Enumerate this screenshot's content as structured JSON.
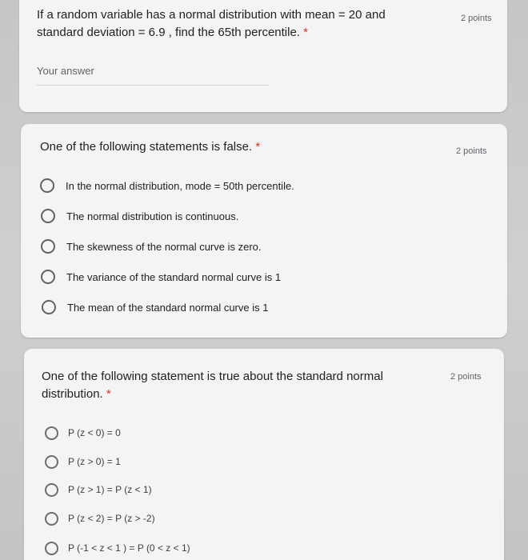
{
  "questions": [
    {
      "title_line1": "If a random variable has a normal distribution with mean = 20 and",
      "title_line2": "standard deviation = 6.9 , find the 65th percentile.",
      "required_mark": "*",
      "points": "2 points",
      "answer_placeholder": "Your answer"
    },
    {
      "title": "One of the following statements is false.",
      "required_mark": "*",
      "points": "2 points",
      "options": [
        "In the normal distribution, mode = 50th percentile.",
        "The normal distribution is continuous.",
        "The skewness of the normal curve is zero.",
        "The variance of the standard normal curve is 1",
        "The mean of the standard normal curve is 1"
      ]
    },
    {
      "title_line1": "One of the following statement is true about the standard normal",
      "title_line2": "distribution.",
      "required_mark": "*",
      "points": "2 points",
      "options": [
        "P (z < 0) = 0",
        "P (z > 0) = 1",
        "P (z > 1) = P (z < 1)",
        "P (z < 2) = P (z > -2)",
        "P (-1 < z < 1 ) = P (0 < z < 1)"
      ]
    }
  ],
  "colors": {
    "required": "#d93025",
    "card_bg": "#f4f4f4",
    "page_bg": "#c9c9c9"
  }
}
